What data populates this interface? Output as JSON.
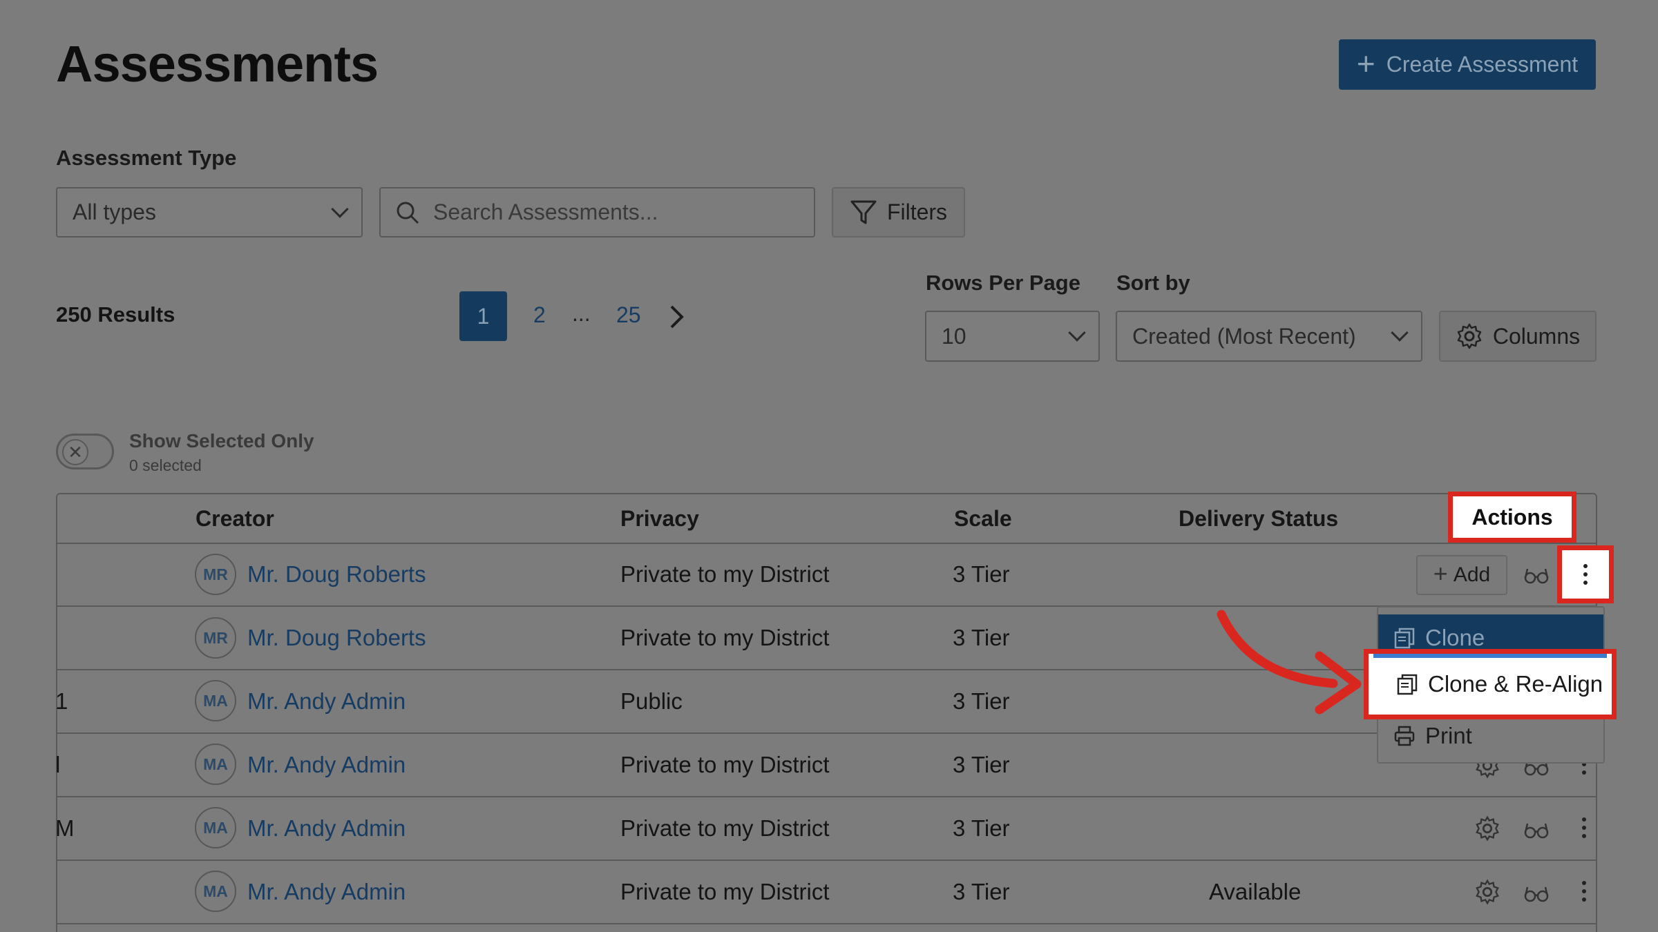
{
  "header": {
    "title": "Assessments",
    "create_button": "Create Assessment"
  },
  "filters": {
    "assessment_type_label": "Assessment Type",
    "assessment_type_value": "All types",
    "search_placeholder": "Search Assessments...",
    "filters_button": "Filters"
  },
  "results": {
    "count_label": "250 Results",
    "pagination": {
      "current": "1",
      "next": "2",
      "ellipsis": "...",
      "last": "25"
    },
    "rows_per_page_label": "Rows Per Page",
    "rows_per_page_value": "10",
    "sort_by_label": "Sort by",
    "sort_by_value": "Created (Most Recent)",
    "columns_button": "Columns"
  },
  "toggle": {
    "label": "Show Selected Only",
    "sublabel": "0 selected"
  },
  "table": {
    "headers": {
      "creator": "Creator",
      "privacy": "Privacy",
      "scale": "Scale",
      "delivery_status": "Delivery Status",
      "actions": "Actions"
    },
    "add_button": "Add",
    "rows": [
      {
        "fragment": "",
        "initials": "MR",
        "creator": "Mr. Doug Roberts",
        "privacy": "Private to my District",
        "scale": "3 Tier",
        "status": ""
      },
      {
        "fragment": "",
        "initials": "MR",
        "creator": "Mr. Doug Roberts",
        "privacy": "Private to my District",
        "scale": "3 Tier",
        "status": ""
      },
      {
        "fragment": "1",
        "initials": "MA",
        "creator": "Mr. Andy Admin",
        "privacy": "Public",
        "scale": "3 Tier",
        "status": ""
      },
      {
        "fragment": "l",
        "initials": "MA",
        "creator": "Mr. Andy Admin",
        "privacy": "Private to my District",
        "scale": "3 Tier",
        "status": ""
      },
      {
        "fragment": "M",
        "initials": "MA",
        "creator": "Mr. Andy Admin",
        "privacy": "Private to my District",
        "scale": "3 Tier",
        "status": ""
      },
      {
        "fragment": "",
        "initials": "MA",
        "creator": "Mr. Andy Admin",
        "privacy": "Private to my District",
        "scale": "3 Tier",
        "status": "Available"
      }
    ]
  },
  "menu": {
    "items": [
      "Clone",
      "Clone & Re-Align",
      "Print"
    ]
  },
  "colors": {
    "primary": "#143a5e",
    "link": "#173c63",
    "highlight": "#d9271f"
  }
}
